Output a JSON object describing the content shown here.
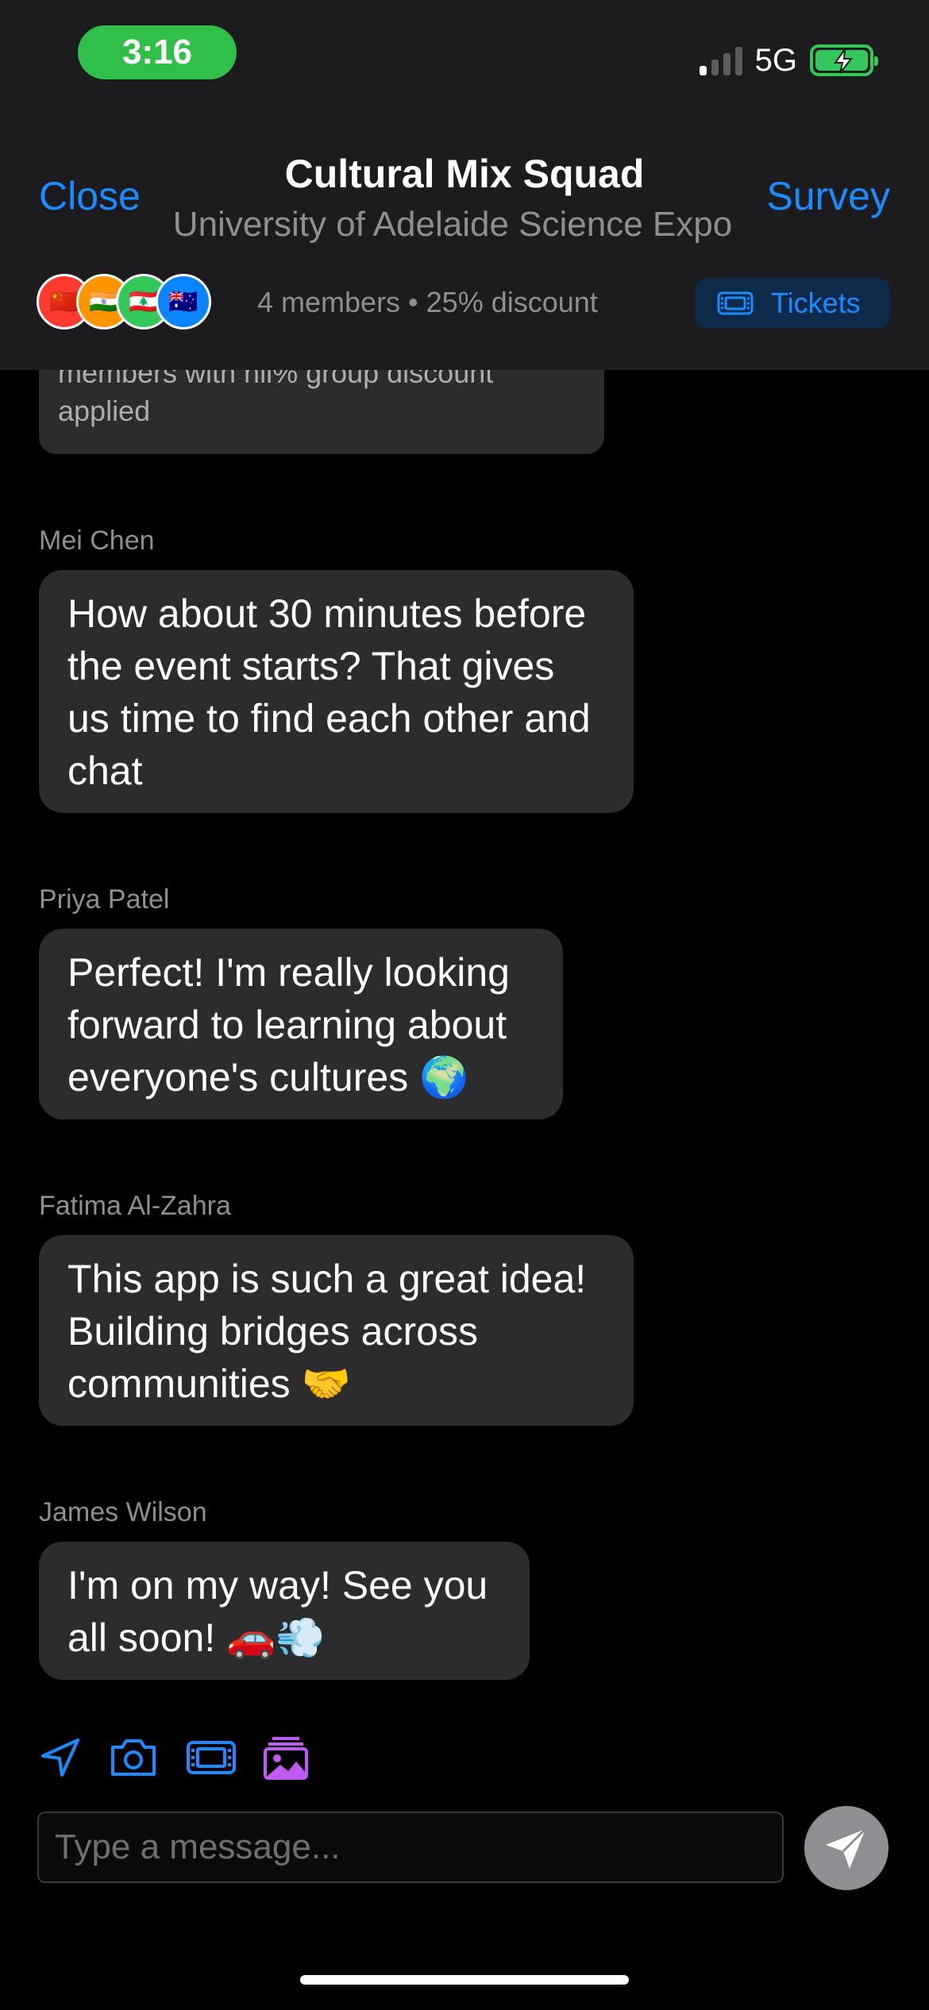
{
  "status_bar": {
    "time": "3:16",
    "network": "5G"
  },
  "header": {
    "close_label": "Close",
    "title": "Cultural Mix Squad",
    "subtitle": "University of Adelaide Science Expo",
    "survey_label": "Survey",
    "avatars": [
      {
        "flag": "🇨🇳",
        "color": "#ff3b30"
      },
      {
        "flag": "🇮🇳",
        "color": "#ff9500"
      },
      {
        "flag": "🇱🇧",
        "color": "#34c759"
      },
      {
        "flag": "🇦🇺",
        "color": "#0a84ff"
      }
    ],
    "members_summary": "4 members • 25% discount",
    "tickets_label": "Tickets"
  },
  "partial_message": "members with nil% group discount\napplied",
  "messages": [
    {
      "sender": "Mei Chen",
      "text": "How about 30 minutes before the event starts? That gives us time to find each other and chat"
    },
    {
      "sender": "Priya Patel",
      "text": "Perfect! I'm really looking forward to learning about everyone's cultures 🌍"
    },
    {
      "sender": "Fatima Al-Zahra",
      "text": "This app is such a great idea! Building bridges across communities 🤝"
    },
    {
      "sender": "James Wilson",
      "text": "I'm on my way! See you all soon! 🚗💨"
    }
  ],
  "composer": {
    "placeholder": "Type a message..."
  },
  "colors": {
    "accent": "#1a8cff",
    "bubble": "#2c2c2e",
    "photo_tool": "#bf5af2"
  }
}
